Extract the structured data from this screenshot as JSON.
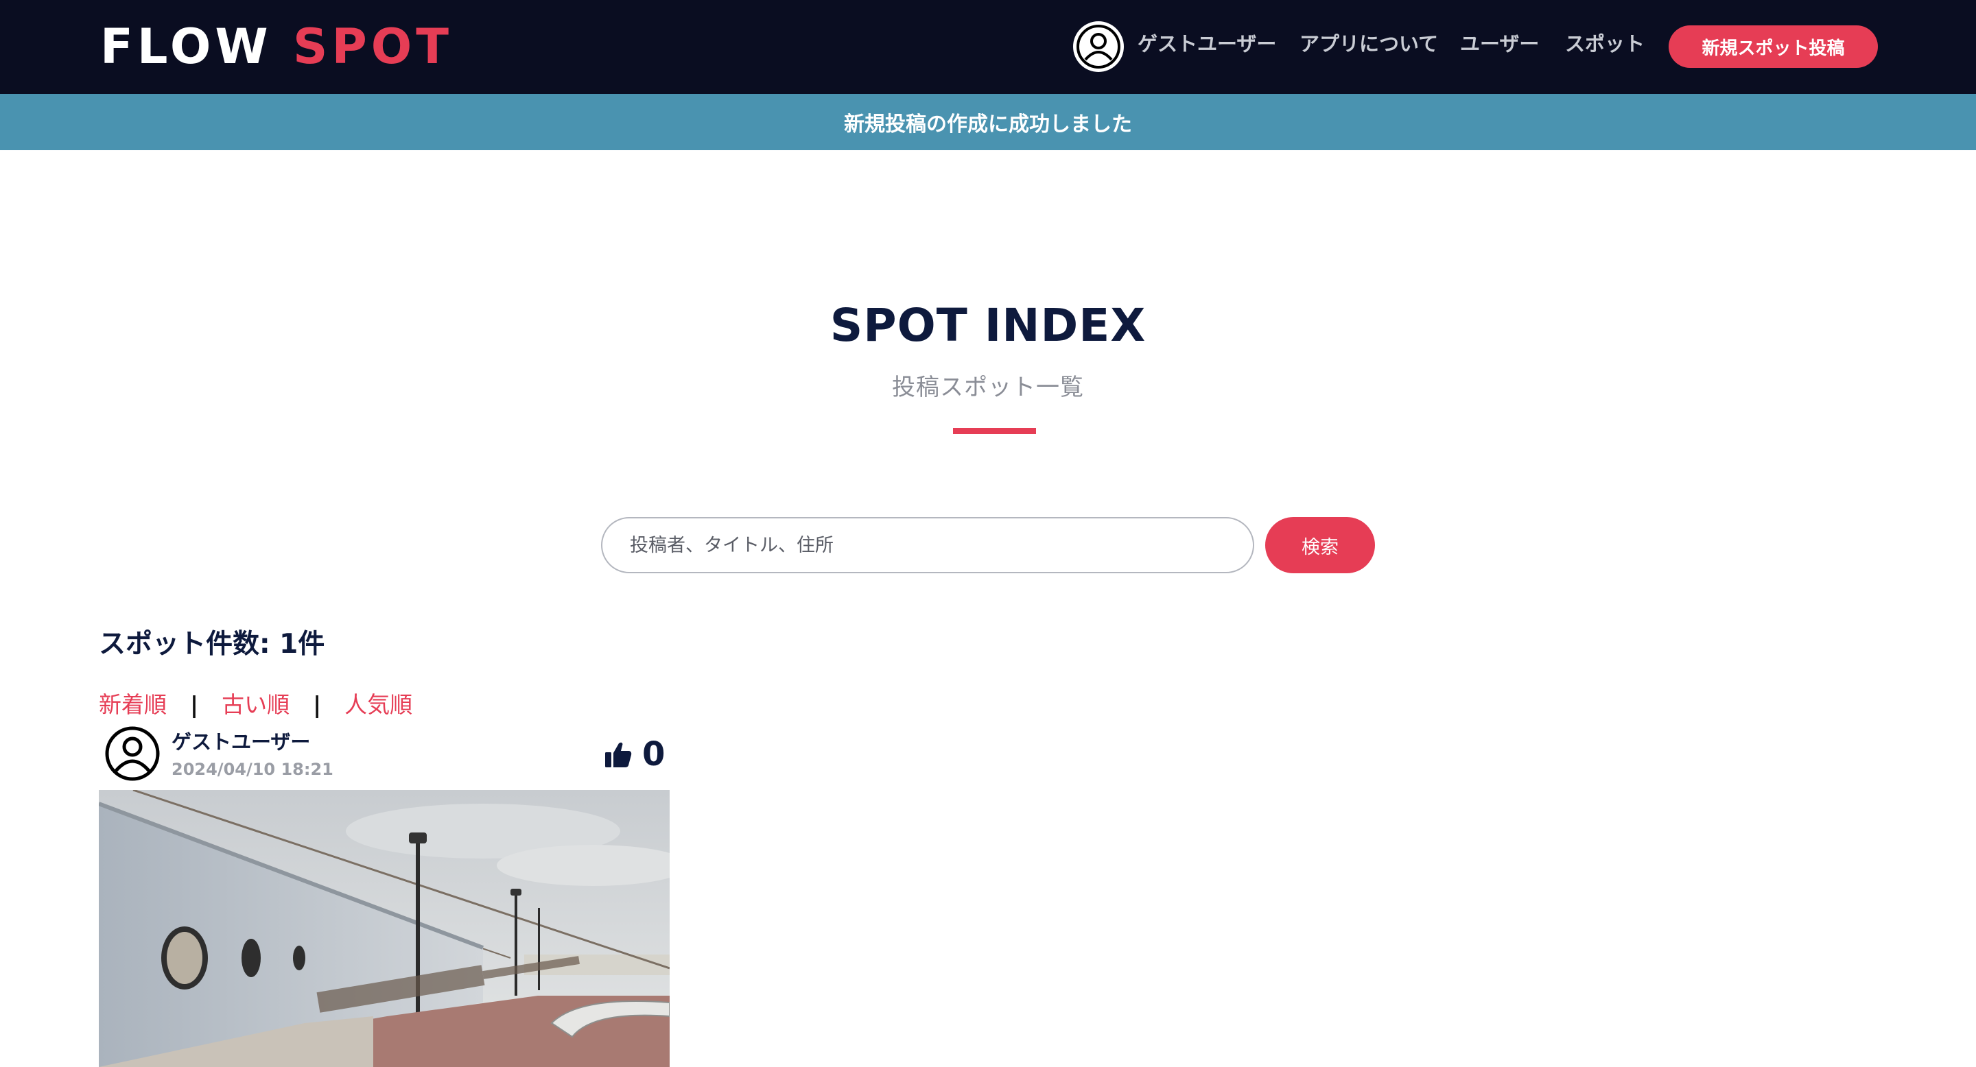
{
  "header": {
    "logo_word1": "FLOW",
    "logo_word2": "SPOT",
    "user_label": "ゲストユーザー",
    "nav": {
      "about": "アプリについて",
      "users": "ユーザー",
      "spots": "スポット"
    },
    "post_button": "新規スポット投稿"
  },
  "flash": {
    "message": "新規投稿の作成に成功しました"
  },
  "page": {
    "title": "SPOT INDEX",
    "subtitle": "投稿スポット一覧"
  },
  "search": {
    "placeholder": "投稿者、タイトル、住所",
    "button": "検索"
  },
  "list": {
    "count_label": "スポット件数: 1件",
    "sort": {
      "newest": "新着順",
      "oldest": "古い順",
      "popular": "人気順",
      "separator": "|"
    },
    "spots": [
      {
        "username": "ゲストユーザー",
        "date": "2024/04/10 18:21",
        "likes": "0",
        "image_icon": "seaside-promenade-photo"
      }
    ]
  },
  "colors": {
    "navbar": "#0a0d21",
    "accent": "#e63d55",
    "flash": "#4a93b0",
    "heading": "#0e1a3d",
    "muted": "#8a8d96"
  }
}
